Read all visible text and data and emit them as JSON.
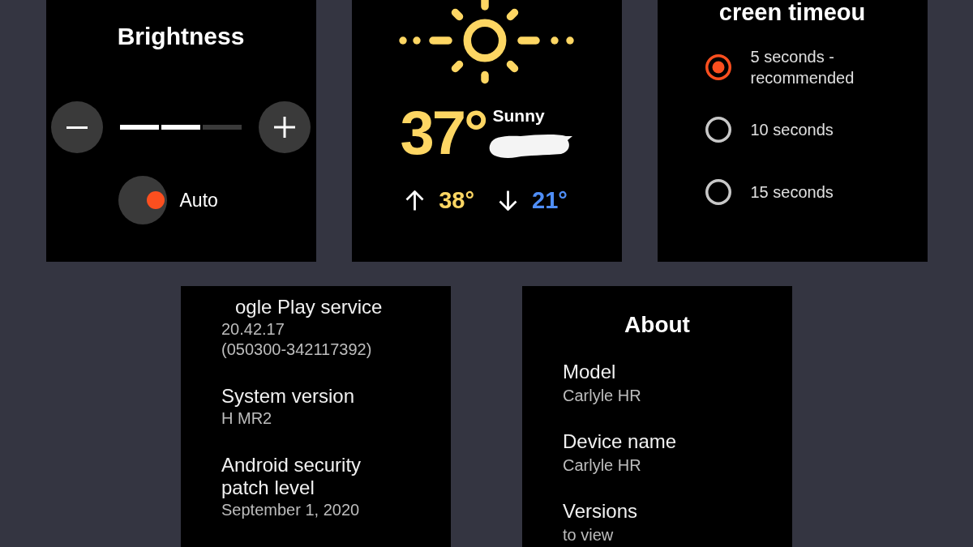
{
  "brightness": {
    "title": "Brightness",
    "level": 0.67,
    "auto": {
      "label": "Auto",
      "on": true
    }
  },
  "weather": {
    "temperature": "37°",
    "condition": "Sunny",
    "high": "38°",
    "low": "21°"
  },
  "screen_timeout": {
    "title": "creen timeou",
    "options": [
      {
        "label": "5 seconds - recommended",
        "selected": true
      },
      {
        "label": "10 seconds",
        "selected": false
      },
      {
        "label": "15 seconds",
        "selected": false
      }
    ]
  },
  "versions_list": {
    "items": [
      {
        "title": "ogle Play service",
        "value": "20.42.17 (050300-342117392)"
      },
      {
        "title": "System version",
        "value": "H MR2"
      },
      {
        "title": "Android security patch level",
        "value": "September 1, 2020"
      }
    ]
  },
  "about": {
    "title": "About",
    "items": [
      {
        "title": "Model",
        "value": "Carlyle HR"
      },
      {
        "title": "Device name",
        "value": "Carlyle HR"
      },
      {
        "title": "Versions",
        "value": "to view"
      }
    ]
  }
}
